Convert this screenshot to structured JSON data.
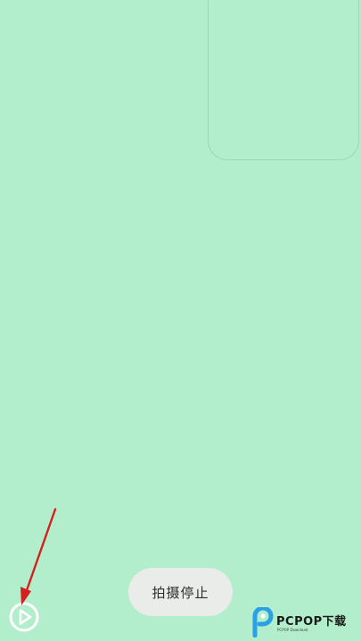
{
  "screen": {
    "background_color": "#b2eecb"
  },
  "toast": {
    "label": "拍摄停止"
  },
  "play_button": {
    "icon": "play-circle-icon",
    "color": "#ffffff"
  },
  "annotation": {
    "icon": "red-arrow-icon",
    "color": "#d62020"
  },
  "watermark": {
    "brand": "PCPOP下载",
    "subtext": "PCPOP Download",
    "logo_color": "#2aa0e6"
  }
}
